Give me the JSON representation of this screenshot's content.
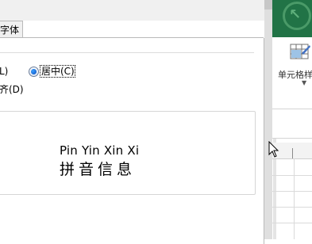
{
  "dialog": {
    "tab_font": "字体",
    "option_left_partial": "L)",
    "option_center": "居中(C)",
    "option_distributed_partial": "齐(D)"
  },
  "preview": {
    "pinyin": "Pin Yin Xin  Xi",
    "hanzi": "拼音信息"
  },
  "excel": {
    "cell_style_label": "单元格样",
    "theme_color": "#217346"
  }
}
